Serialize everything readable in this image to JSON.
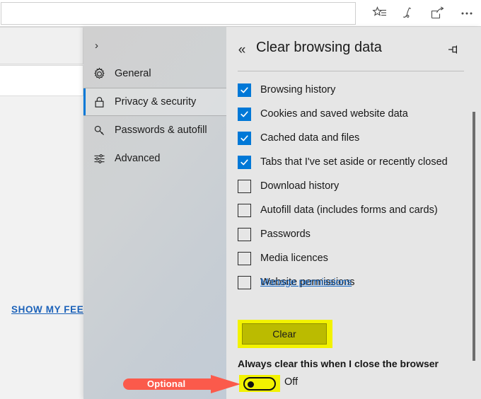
{
  "browser": {
    "address_bar_value": "",
    "address_bar_placeholder": "",
    "toolbar_buttons": [
      {
        "name": "favorites-icon",
        "label": "Favorites"
      },
      {
        "name": "notes-icon",
        "label": "Make a Web Note"
      },
      {
        "name": "share-icon",
        "label": "Share"
      },
      {
        "name": "more-icon",
        "label": "Settings and more"
      }
    ]
  },
  "page": {
    "show_my_feed": "SHOW MY FEED"
  },
  "settings": {
    "nav": {
      "forward_label": "",
      "items": [
        {
          "label": "General",
          "icon": "gear-icon",
          "selected": false
        },
        {
          "label": "Privacy & security",
          "icon": "lock-icon",
          "selected": true
        },
        {
          "label": "Passwords & autofill",
          "icon": "key-icon",
          "selected": false
        },
        {
          "label": "Advanced",
          "icon": "sliders-icon",
          "selected": false
        }
      ]
    },
    "panel": {
      "back_label": "«",
      "title": "Clear browsing data",
      "pin_label": "Pin",
      "checkboxes": [
        {
          "label": "Browsing history",
          "checked": true
        },
        {
          "label": "Cookies and saved website data",
          "checked": true
        },
        {
          "label": "Cached data and files",
          "checked": true
        },
        {
          "label": "Tabs that I've set aside or recently closed",
          "checked": true
        },
        {
          "label": "Download history",
          "checked": false
        },
        {
          "label": "Autofill data (includes forms and cards)",
          "checked": false
        },
        {
          "label": "Passwords",
          "checked": false
        },
        {
          "label": "Media licences",
          "checked": false
        },
        {
          "label": "Website permissions",
          "checked": false
        }
      ],
      "manage_permissions_link": "Manage permissions",
      "clear_button": "Clear",
      "always_clear_label": "Always clear this when I close the browser",
      "toggle_state": "Off"
    }
  },
  "annotations": {
    "arrow_label": "Optional",
    "arrow_color": "#fb5a4b",
    "highlight_color": "#f2f200"
  },
  "colors": {
    "accent": "#0078d7",
    "link": "#1464c0",
    "feed_link": "#1c62b9",
    "panel_bg": "#e6e6e6",
    "nav_bg": "#cfd2d4",
    "clear_button_bg": "#bbbb00"
  }
}
